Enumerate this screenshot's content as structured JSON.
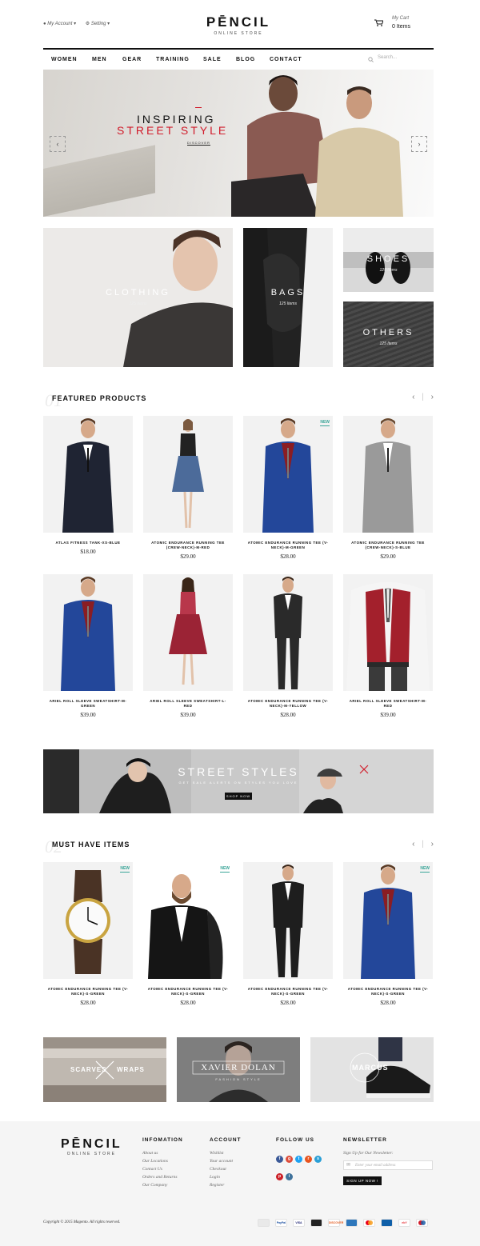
{
  "header": {
    "account_label": "My Account",
    "setting_label": "Setting",
    "logo_name": "PĒNCIL",
    "logo_sub": "ONLINE STORE",
    "cart_label": "My Cart",
    "cart_items": "0 Items"
  },
  "nav": {
    "items": [
      "WOMEN",
      "MEN",
      "GEAR",
      "TRAINING",
      "SALE",
      "BLOG",
      "CONTACT"
    ],
    "search_placeholder": "Search..."
  },
  "hero": {
    "line1": "INSPIRING",
    "line2": "STREET STYLE",
    "cta": "DISCOVER",
    "prev": "‹",
    "next": "›"
  },
  "categories": [
    {
      "label": "CLOTHING",
      "count": "125 Items"
    },
    {
      "label": "BAGS",
      "count": "125 Items"
    },
    {
      "label": "SHOES",
      "count": "125 Items"
    },
    {
      "label": "OTHERS",
      "count": "125 Items"
    }
  ],
  "featured": {
    "number": "01",
    "title": "FEATURED PRODUCTS",
    "products": [
      {
        "name": "ATLAS FITNESS TANK-XS-BLUE",
        "price": "$18.00",
        "badge": ""
      },
      {
        "name": "ATOMIC ENDURANCE RUNNING TEE (CREW-NECK)-M-RED",
        "price": "$29.00",
        "badge": ""
      },
      {
        "name": "ATOMIC ENDURANCE RUNNING TEE (V-NECK)-M-GREEN",
        "price": "$28.00",
        "badge": "NEW"
      },
      {
        "name": "ATOMIC ENDURANCE RUNNING TEE (CREW-NECK)-S-BLUE",
        "price": "$29.00",
        "badge": ""
      },
      {
        "name": "ARIEL ROLL SLEEVE SWEATSHIRT-M-GREEN",
        "price": "$39.00",
        "badge": ""
      },
      {
        "name": "ARIEL ROLL SLEEVE SWEATSHIRT-L-RED",
        "price": "$39.00",
        "badge": ""
      },
      {
        "name": "ATOMIC ENDURANCE RUNNING TEE (V-NECK)-M-YELLOW",
        "price": "$28.00",
        "badge": ""
      },
      {
        "name": "ARIEL ROLL SLEEVE SWEATSHIRT-M-RED",
        "price": "$39.00",
        "badge": ""
      }
    ]
  },
  "street_banner": {
    "title": "STREET STYLES",
    "subtitle": "GET SALE ALERTS ON STYLES YOU LOVE",
    "button": "SHOP NOW"
  },
  "must_have": {
    "number": "02",
    "title": "MUST HAVE ITEMS",
    "products": [
      {
        "name": "ATOMIC ENDURANCE RUNNING TEE (V-NECK)-S-GREEN",
        "price": "$28.00",
        "badge": "NEW"
      },
      {
        "name": "ATOMIC ENDURANCE RUNNING TEE (V-NECK)-S-GREEN",
        "price": "$28.00",
        "badge": "NEW"
      },
      {
        "name": "ATOMIC ENDURANCE RUNNING TEE (V-NECK)-S-GREEN",
        "price": "$28.00",
        "badge": ""
      },
      {
        "name": "ATOMIC ENDURANCE RUNNING TEE (V-NECK)-S-GREEN",
        "price": "$28.00",
        "badge": "NEW"
      }
    ]
  },
  "brands": [
    {
      "left": "SCARVES",
      "right": "WRAPS"
    },
    {
      "name": "XAVIER DOLAN",
      "sub": "FASHION STYLE"
    },
    {
      "name": "MARCUS"
    }
  ],
  "footer": {
    "logo_name": "PĒNCIL",
    "logo_sub": "ONLINE STORE",
    "info_title": "INFOMATION",
    "info_links": [
      "About us",
      "Our Locations",
      "Contact Us",
      "Orders and Returns",
      "Our Company"
    ],
    "account_title": "ACCOUNT",
    "account_links": [
      "Wishlist",
      "Your account",
      "Checkout",
      "Login",
      "Register"
    ],
    "follow_title": "FOLLOW US",
    "newsletter_title": "NEWSLETTER",
    "newsletter_text": "Sign Up for Our Newsletter:",
    "email_placeholder": "Enter your email address",
    "signup_button": "SIGN UP NOW !",
    "copyright": "Copyright © 2015 Magento. All rights reserved.",
    "payments": [
      "",
      "PayPal",
      "VISA",
      "",
      "DISCOVER",
      "",
      "",
      "",
      "ebY",
      ""
    ]
  },
  "colors": {
    "accent_red": "#d11c2b",
    "badge_teal": "#3aa598",
    "dark": "#111111"
  }
}
